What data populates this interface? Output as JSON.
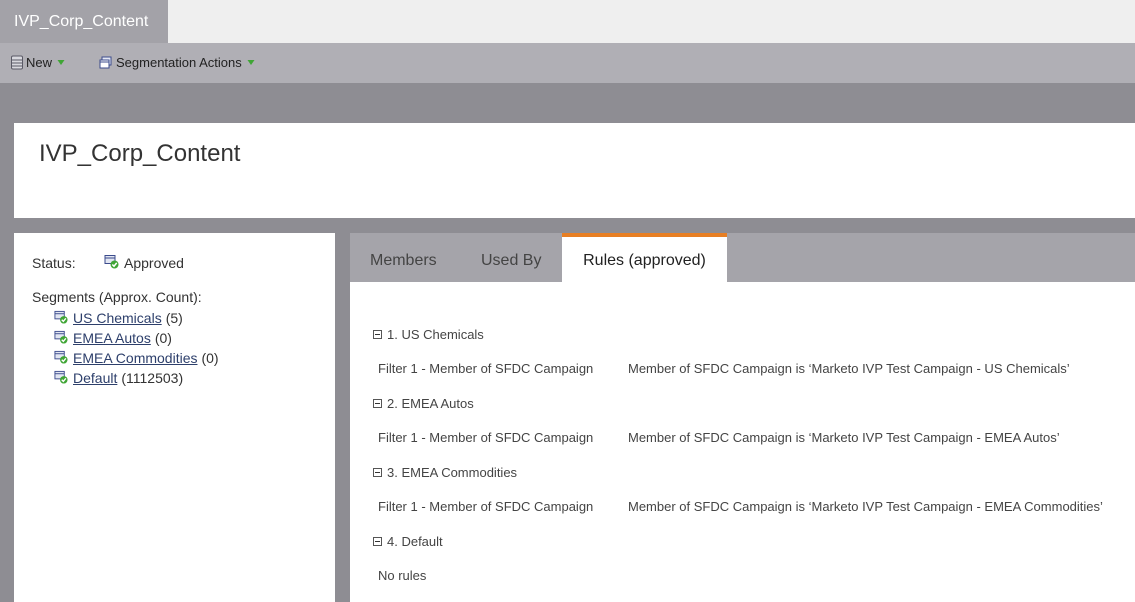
{
  "document_tab": {
    "title": "IVP_Corp_Content"
  },
  "toolbar": {
    "new_label": "New",
    "segmentation_actions_label": "Segmentation Actions"
  },
  "header": {
    "title": "IVP_Corp_Content"
  },
  "left_panel": {
    "status_label": "Status:",
    "status_value": "Approved",
    "segments_title": "Segments (Approx. Count):",
    "segments": [
      {
        "name": "US Chemicals",
        "count": "(5)"
      },
      {
        "name": "EMEA Autos",
        "count": "(0)"
      },
      {
        "name": "EMEA Commodities",
        "count": "(0)"
      },
      {
        "name": "Default",
        "count": "(1112503)"
      }
    ]
  },
  "tabs": [
    {
      "label": "Members"
    },
    {
      "label": "Used By"
    },
    {
      "label": "Rules (approved)"
    }
  ],
  "active_tab": "Rules (approved)",
  "rules": [
    {
      "title": "1. US Chemicals",
      "filter": "Filter 1 - Member of SFDC Campaign",
      "description": "Member of SFDC Campaign is ‘Marketo IVP Test Campaign - US Chemicals’"
    },
    {
      "title": "2. EMEA Autos",
      "filter": "Filter 1 - Member of SFDC Campaign",
      "description": "Member of SFDC Campaign is ‘Marketo IVP Test Campaign - EMEA Autos’"
    },
    {
      "title": "3. EMEA Commodities",
      "filter": "Filter 1 - Member of SFDC Campaign",
      "description": "Member of SFDC Campaign is ‘Marketo IVP Test Campaign - EMEA Commodities’"
    },
    {
      "title": "4. Default",
      "no_rules": "No rules"
    }
  ],
  "colors": {
    "accent_tab_border": "#e77f24",
    "link": "#2d3f6b",
    "background": "#8e8d93"
  },
  "icons": {
    "new": "database-icon",
    "segmentation_actions": "window-icon",
    "status": "approved-segment-icon",
    "segment": "segment-check-icon",
    "rule_toggle": "collapse-icon"
  }
}
